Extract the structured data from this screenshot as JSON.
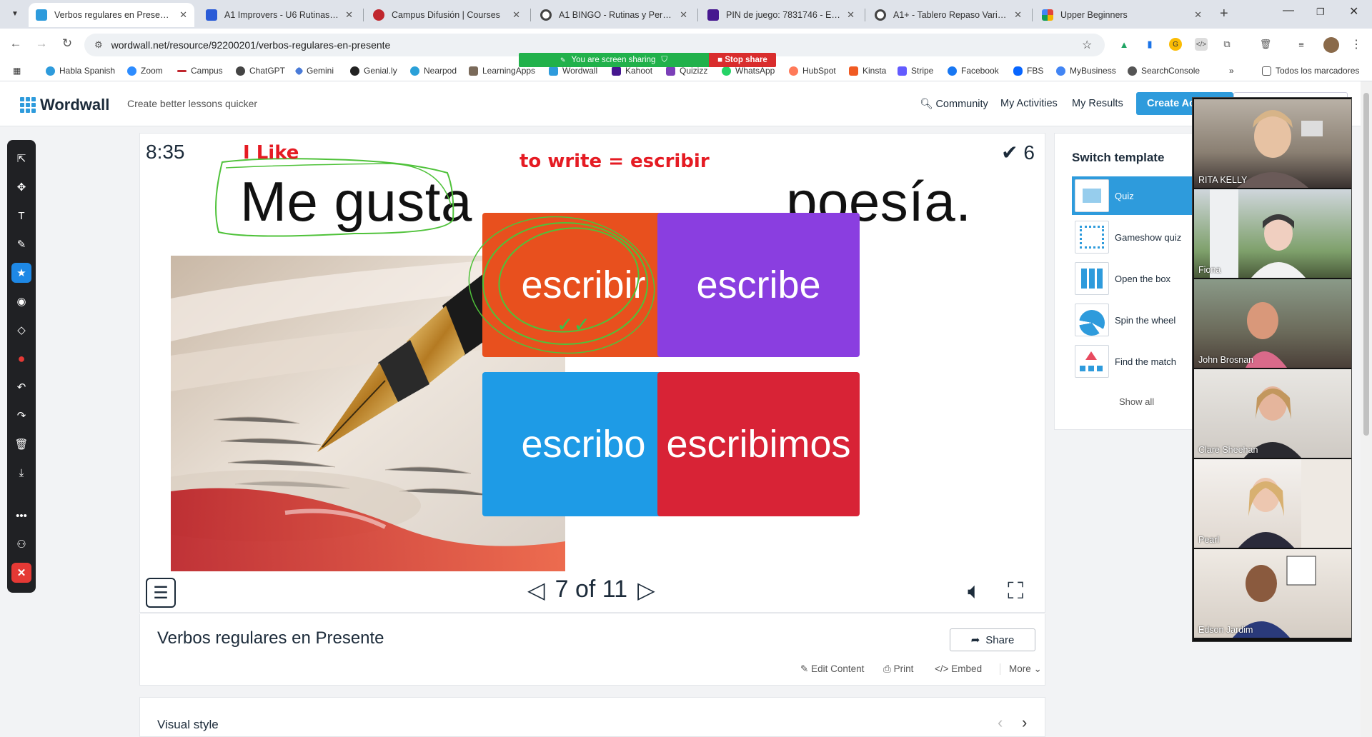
{
  "browser": {
    "tabs": [
      {
        "title": "Verbos regulares en Presente -",
        "active": true,
        "color": "#2e9bdc"
      },
      {
        "title": "A1 Improvers - U6 Rutinas y Co",
        "active": false,
        "color": "#2a5bd7"
      },
      {
        "title": "Campus Difusión | Courses",
        "active": false,
        "color": "#c0262d"
      },
      {
        "title": "A1 BINGO - Rutinas y Personali",
        "active": false,
        "color": "#4a4a4a"
      },
      {
        "title": "PIN de juego: 7831746 - Espera",
        "active": false,
        "color": "#46178f"
      },
      {
        "title": "A1+ - Tablero Repaso Variado",
        "active": false,
        "color": "#4a4a4a"
      },
      {
        "title": "Upper Beginners",
        "active": false,
        "color": "#e2443a"
      }
    ],
    "url": "wordwall.net/resource/92200201/verbos-regulares-en-presente",
    "bookmarks": [
      {
        "label": "Habla Spanish",
        "color": "#2e9bdc"
      },
      {
        "label": "Zoom",
        "color": "#2d8cff"
      },
      {
        "label": "Campus",
        "color": "#c0262d"
      },
      {
        "label": "ChatGPT",
        "color": "#444444"
      },
      {
        "label": "Gemini",
        "color": "#4a7bd8"
      },
      {
        "label": "Genial.ly",
        "color": "#222222"
      },
      {
        "label": "Nearpod",
        "color": "#2aa0d8"
      },
      {
        "label": "LearningApps",
        "color": "#7a6a5a"
      },
      {
        "label": "Wordwall",
        "color": "#2e9bdc"
      },
      {
        "label": "Kahoot",
        "color": "#46178f"
      },
      {
        "label": "Quizizz",
        "color": "#7b3fb8"
      },
      {
        "label": "WhatsApp",
        "color": "#25d366"
      },
      {
        "label": "HubSpot",
        "color": "#ff7a59"
      },
      {
        "label": "Kinsta",
        "color": "#f05a22"
      },
      {
        "label": "Stripe",
        "color": "#635bff"
      },
      {
        "label": "Facebook",
        "color": "#1877f2"
      },
      {
        "label": "FBS",
        "color": "#0866ff"
      },
      {
        "label": "MyBusiness",
        "color": "#4285f4"
      },
      {
        "label": "SearchConsole",
        "color": "#555555"
      }
    ],
    "other_bookmarks": "Todos los marcadores",
    "share_text": "You are screen sharing",
    "stop_share": "Stop share"
  },
  "wordwall": {
    "logo": "Wordwall",
    "tagline": "Create better lessons quicker",
    "nav": [
      "Community",
      "My Activities",
      "My Results"
    ],
    "create_button": "Create Ac"
  },
  "game": {
    "timer": "8:35",
    "score": "6",
    "question": "Me gusta _________ poesía.",
    "answers": [
      {
        "text": "escribir",
        "color": "#e8501e"
      },
      {
        "text": "escribe",
        "color": "#8a3ee0"
      },
      {
        "text": "escribo",
        "color": "#1e9be6"
      },
      {
        "text": "escribimos",
        "color": "#d82336"
      }
    ],
    "counter": "7 of 11",
    "annotations": {
      "note1": "I Like",
      "note2": "to write = escribir"
    }
  },
  "activity": {
    "title": "Verbos regulares en Presente",
    "share": "Share",
    "actions": [
      "Edit Content",
      "Print",
      "Embed",
      "More"
    ],
    "visual_style": "Visual style"
  },
  "switch_template": {
    "heading": "Switch template",
    "templates": [
      "Quiz",
      "Gameshow quiz",
      "Open the box",
      "Spin the wheel",
      "Find the match"
    ],
    "show_all": "Show all"
  },
  "participants": [
    "RITA KELLY",
    "Fiona",
    "John Brosnan",
    "Clare Sheehan",
    "Pearl",
    "Edson Jardim"
  ]
}
